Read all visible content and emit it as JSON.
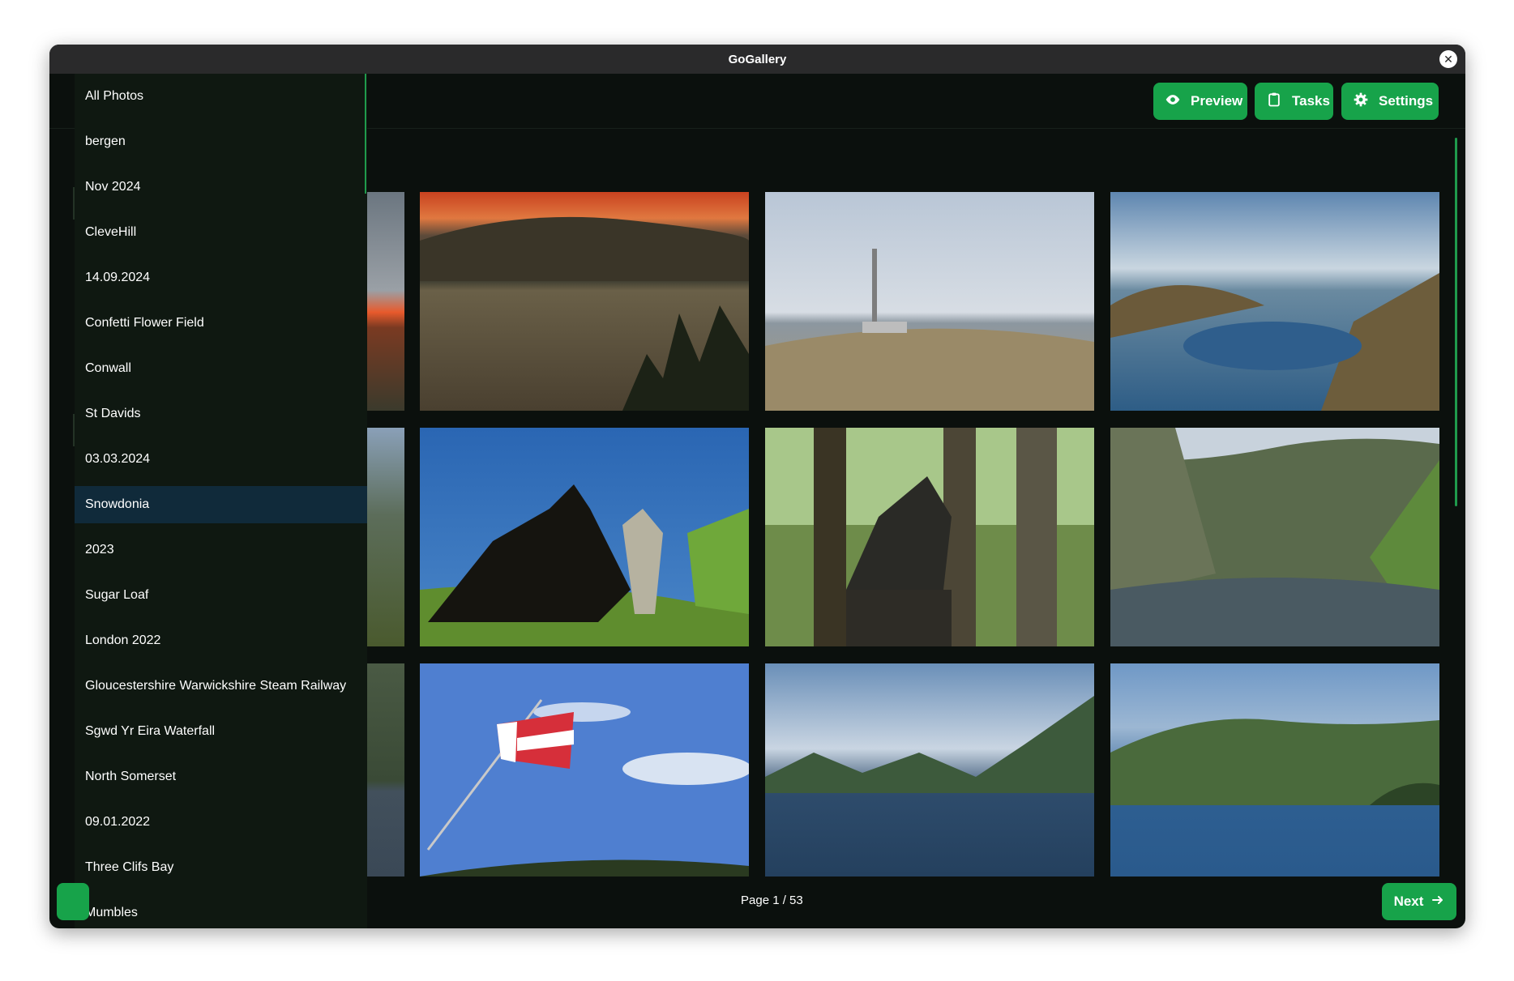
{
  "app": {
    "title": "GoGallery"
  },
  "toolbar": {
    "preview_label": "Preview",
    "tasks_label": "Tasks",
    "settings_label": "Settings"
  },
  "sidebar": {
    "items": [
      "All Photos",
      "bergen",
      "Nov 2024",
      "CleveHill",
      "14.09.2024",
      "Confetti Flower Field",
      "Conwall",
      "St Davids",
      "03.03.2024",
      "Snowdonia",
      "2023",
      "Sugar Loaf",
      "London 2022",
      "Gloucestershire Warwickshire Steam Railway",
      "Sgwd Yr Eira Waterfall",
      "North Somerset",
      "09.01.2022",
      "Three Clifs Bay",
      "Mumbles"
    ],
    "active_index": 9
  },
  "pagination": {
    "page_text": "Page 1 / 53",
    "next_label": "Next"
  },
  "colors": {
    "accent": "#17a34a",
    "background": "#0b100d",
    "sidebar": "#0f1811",
    "active_item": "#102a3a"
  }
}
